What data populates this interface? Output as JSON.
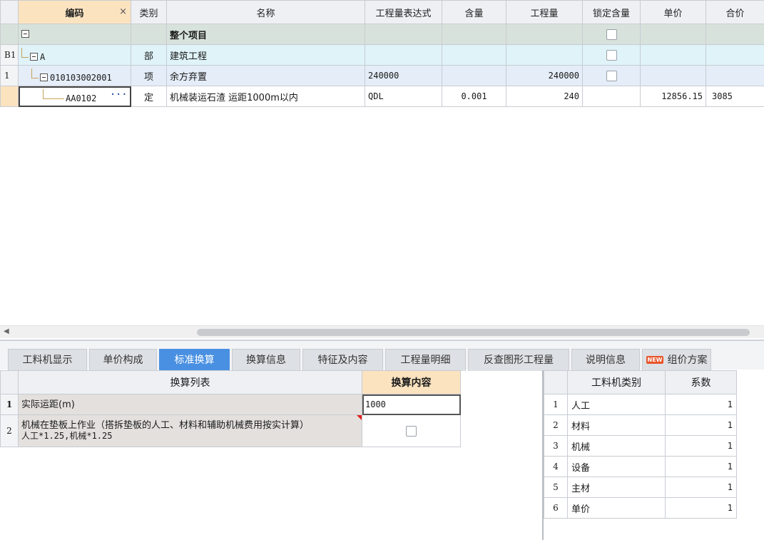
{
  "top_grid": {
    "columns": [
      "编码",
      "类别",
      "名称",
      "工程量表达式",
      "含量",
      "工程量",
      "锁定含量",
      "单价",
      "合价"
    ],
    "close_icon": "×",
    "rows": [
      {
        "rownum": "",
        "code": "",
        "category": "",
        "name": "整个项目",
        "expr": "",
        "content": "",
        "qty": "",
        "unit_price": "",
        "total": ""
      },
      {
        "rownum": "B1",
        "code": "A",
        "category": "部",
        "name": "建筑工程",
        "expr": "",
        "content": "",
        "qty": "",
        "unit_price": "",
        "total": ""
      },
      {
        "rownum": "1",
        "code": "010103002001",
        "category": "项",
        "name": "余方弃置",
        "expr": "240000",
        "content": "",
        "qty": "240000",
        "unit_price": "",
        "total": ""
      },
      {
        "rownum": "",
        "code": "AA0102",
        "category": "定",
        "name": "机械装运石渣 运距1000m以内",
        "expr": "QDL",
        "content": "0.001",
        "qty": "240",
        "unit_price": "12856.15",
        "total": "3085"
      }
    ],
    "ellipsis": "···"
  },
  "tabs": [
    {
      "label": "工料机显示"
    },
    {
      "label": "单价构成"
    },
    {
      "label": "标准换算",
      "active": true
    },
    {
      "label": "换算信息"
    },
    {
      "label": "特征及内容"
    },
    {
      "label": "工程量明细"
    },
    {
      "label": "反查图形工程量"
    },
    {
      "label": "说明信息"
    },
    {
      "label": "组价方案",
      "badge": "NEW"
    }
  ],
  "conversion": {
    "headers": [
      "换算列表",
      "换算内容"
    ],
    "rows": [
      {
        "rownum": "1",
        "label": "实际运距(m)",
        "value": "1000"
      },
      {
        "rownum": "2",
        "label_line1": "机械在垫板上作业（搭拆垫板的人工、材料和辅助机械费用按实计算）",
        "label_line2": "人工*1.25,机械*1.25"
      }
    ]
  },
  "coefficients": {
    "headers": [
      "工料机类别",
      "系数"
    ],
    "rows": [
      {
        "rownum": "1",
        "category": "人工",
        "factor": "1"
      },
      {
        "rownum": "2",
        "category": "材料",
        "factor": "1"
      },
      {
        "rownum": "3",
        "category": "机械",
        "factor": "1"
      },
      {
        "rownum": "4",
        "category": "设备",
        "factor": "1"
      },
      {
        "rownum": "5",
        "category": "主材",
        "factor": "1"
      },
      {
        "rownum": "6",
        "category": "单价",
        "factor": "1"
      }
    ]
  },
  "scrollbar": {
    "left_arrow": "◀"
  }
}
